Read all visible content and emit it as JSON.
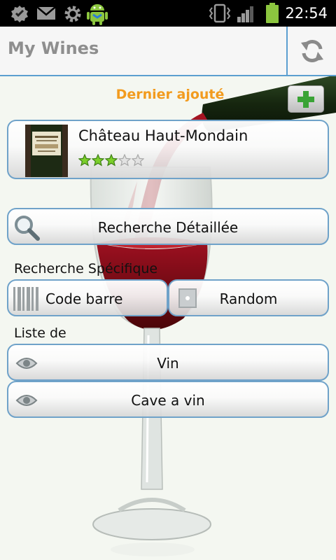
{
  "status_bar": {
    "icons": [
      "settings-icon",
      "mail-icon",
      "gear-icon",
      "android-icon",
      "vibrate-icon",
      "signal-icon",
      "battery-icon"
    ],
    "time": "22:54"
  },
  "header": {
    "title": "My Wines",
    "refresh_icon": "refresh-icon"
  },
  "last_added": {
    "label": "Dernier ajouté",
    "add_icon": "plus-icon",
    "wine": {
      "name": "Château Haut-Mondain",
      "rating": 3,
      "max_rating": 5
    }
  },
  "search": {
    "detailed_label": "Recherche Détaillée",
    "detailed_icon": "magnifier-icon",
    "specific_label": "Recherche Spécifique",
    "barcode_label": "Code barre",
    "barcode_icon": "barcode-icon",
    "random_label": "Random",
    "random_icon": "dice-icon"
  },
  "lists": {
    "label": "Liste de",
    "items": [
      {
        "label": "Vin",
        "icon": "eye-icon"
      },
      {
        "label": "Cave a vin",
        "icon": "eye-icon"
      }
    ]
  },
  "colors": {
    "accent_border": "#6fa2c9",
    "title_underline": "#5b9fd0",
    "section_orange": "#f29b1e",
    "add_green": "#3aa335",
    "star_green": "#7bcf2a"
  }
}
